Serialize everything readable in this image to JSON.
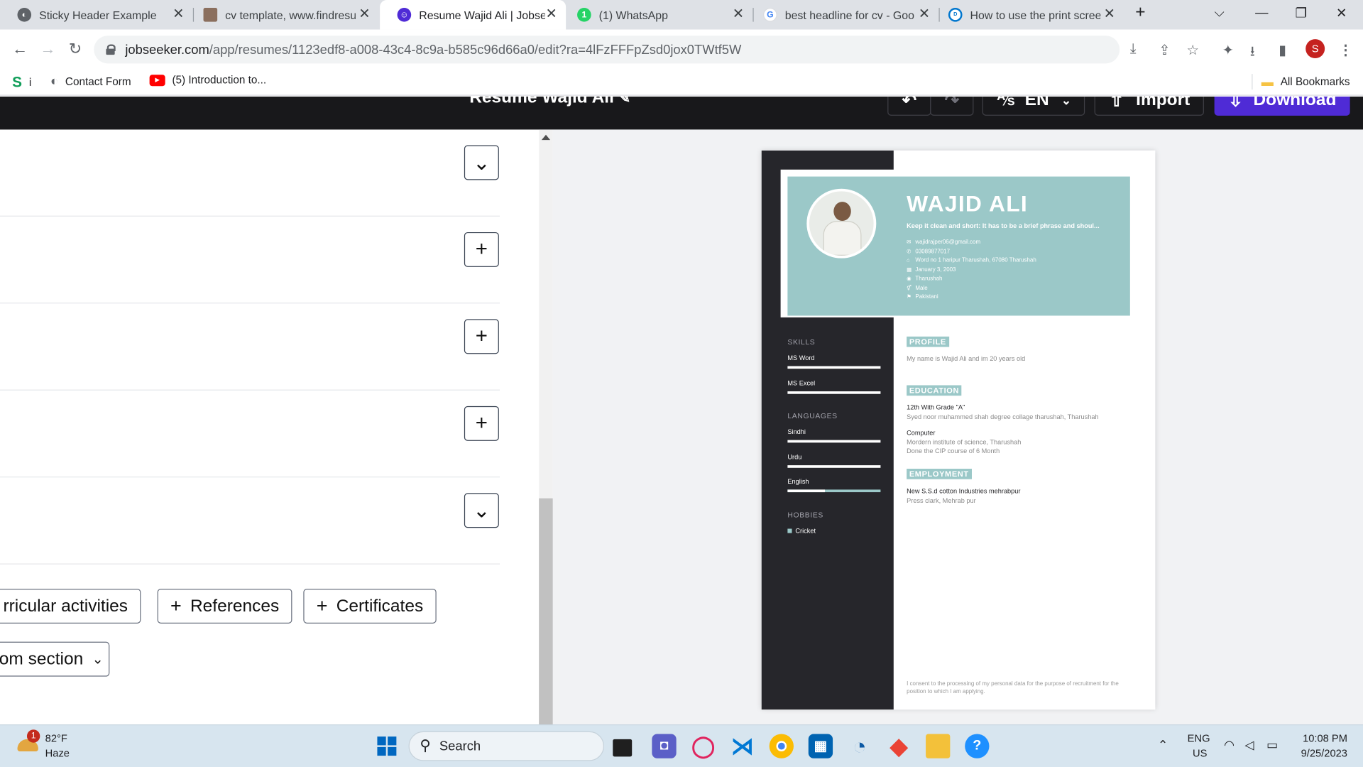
{
  "browser": {
    "tabs": [
      {
        "title": "Sticky Header Example",
        "active": false
      },
      {
        "title": "cv template, www.findresu",
        "active": false
      },
      {
        "title": "Resume Wajid Ali | Jobseek",
        "active": true
      },
      {
        "title": "(1) WhatsApp",
        "active": false
      },
      {
        "title": "best headline for cv - Goo",
        "active": false
      },
      {
        "title": "How to use the print scree",
        "active": false
      }
    ],
    "url_host": "jobseeker.com",
    "url_path": "/app/resumes/1123edf8-a008-43c4-8c9a-b585c96d66a0/edit?ra=4lFzFFFpZsd0jox0TWtf5W",
    "profile_initial": "S",
    "bookmarks": [
      "i",
      "Contact Form",
      "(5) Introduction to..."
    ],
    "all_bookmarks_label": "All Bookmarks"
  },
  "app": {
    "title": "Resume Wajid Ali",
    "language": "EN",
    "import_label": "Import",
    "download_label": "Download",
    "add_sections": [
      "rricular activities",
      "References",
      "Certificates"
    ],
    "custom_section_label": "om section"
  },
  "resume": {
    "name": "WAJID ALI",
    "tagline": "Keep it clean and short: It has to be a brief phrase and shoul...",
    "contacts": [
      {
        "icon": "mail-icon",
        "glyph": "✉",
        "text": "wajidrajper06@gmail.com"
      },
      {
        "icon": "phone-icon",
        "glyph": "✆",
        "text": "03089877017"
      },
      {
        "icon": "home-icon",
        "glyph": "⌂",
        "text": "Word no 1 haripur Tharushah, 67080 Tharushah"
      },
      {
        "icon": "calendar-icon",
        "glyph": "▦",
        "text": "January 3, 2003"
      },
      {
        "icon": "location-icon",
        "glyph": "◉",
        "text": "Tharushah"
      },
      {
        "icon": "gender-icon",
        "glyph": "⚥",
        "text": "Male"
      },
      {
        "icon": "flag-icon",
        "glyph": "⚑",
        "text": "Pakistani"
      }
    ],
    "skills_heading": "SKILLS",
    "skills": [
      {
        "name": "MS Word",
        "level": 1.0
      },
      {
        "name": "MS Excel",
        "level": 1.0
      }
    ],
    "languages_heading": "LANGUAGES",
    "languages": [
      {
        "name": "Sindhi",
        "level": 1.0
      },
      {
        "name": "Urdu",
        "level": 1.0
      },
      {
        "name": "English",
        "level": 0.4
      }
    ],
    "hobbies_heading": "HOBBIES",
    "hobbies": [
      "Cricket"
    ],
    "profile_heading": "PROFILE",
    "profile_text": "My name is Wajid Ali and im 20 years old",
    "education_heading": "EDUCATION",
    "education": [
      {
        "title": "12th With Grade \"A\"",
        "lines": [
          "Syed noor muhammed shah degree collage tharushah, Tharushah"
        ]
      },
      {
        "title": "Computer",
        "lines": [
          "Mordern institute of science, Tharushah",
          "Done the CIP course of 6 Month"
        ]
      }
    ],
    "employment_heading": "EMPLOYMENT",
    "employment": [
      {
        "title": "New S.S.d cotton Industries mehrabpur",
        "lines": [
          "Press clark, Mehrab pur"
        ]
      }
    ],
    "consent": "I consent to the processing of my personal data for the purpose of recruitment for the position to which I am applying."
  },
  "taskbar": {
    "weather_temp": "82°F",
    "weather_desc": "Haze",
    "weather_badge": "1",
    "search_label": "Search",
    "lang_top": "ENG",
    "lang_bottom": "US",
    "time": "10:08 PM",
    "date": "9/25/2023"
  }
}
